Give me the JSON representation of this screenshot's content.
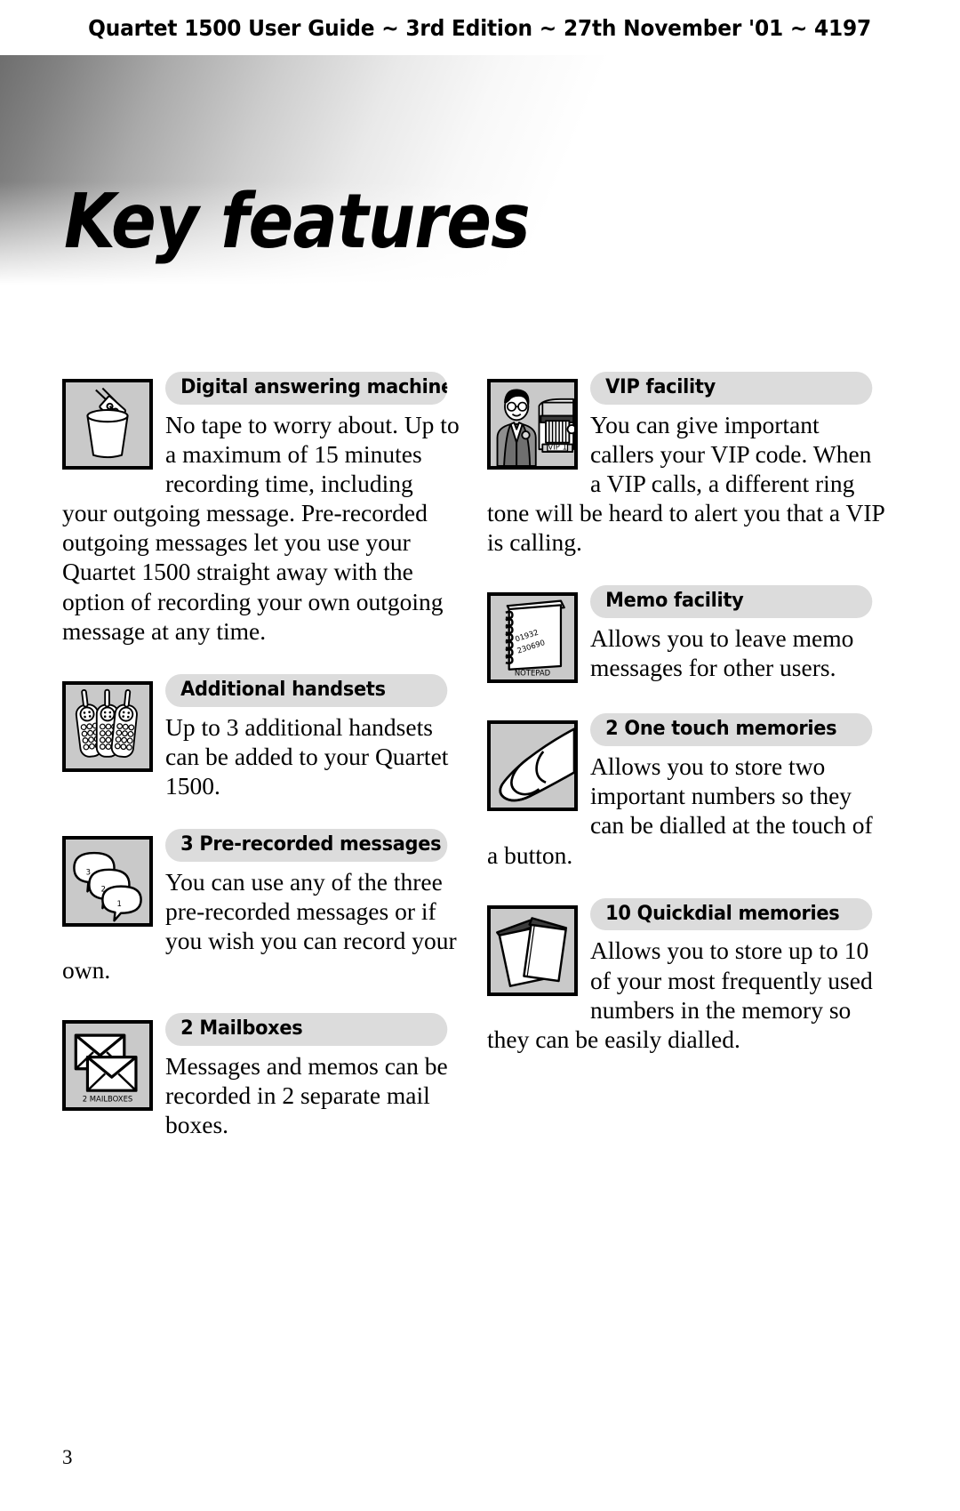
{
  "header": {
    "running_head": "Quartet 1500 User Guide ~ 3rd Edition ~ 27th November '01 ~ 4197"
  },
  "page": {
    "title": "Key features",
    "number": "3"
  },
  "colors": {
    "icon_box_fill": "#c9c9c9",
    "label_pill_fill": "#dcdcdc",
    "ink": "#000000",
    "banner_gradient_start": "#6e6e6e",
    "banner_gradient_end": "#ffffff"
  },
  "columns": {
    "left": [
      {
        "icon_name": "cassette-tape-into-bin-icon",
        "label": "Digital answering machine",
        "body": "No tape to worry about. Up to a maximum of 15 minutes recording time, including your outgoing message. Pre-recorded outgoing messages let you use your Quartet 1500 straight away with the option of recording your own outgoing message at any time."
      },
      {
        "icon_name": "three-cordless-handsets-icon",
        "label": "Additional handsets",
        "body": "Up to 3 additional handsets can be added to your Quartet 1500."
      },
      {
        "icon_name": "three-speech-bubbles-icon",
        "icon_caption": [
          "3",
          "2",
          "1"
        ],
        "label": "3 Pre-recorded messages",
        "body": "You can use any of the three pre-recorded messages or if you wish you can record your own."
      },
      {
        "icon_name": "two-envelopes-icon",
        "icon_caption": "2 MAILBOXES",
        "label": "2 Mailboxes",
        "body": "Messages and memos can be recorded in 2 separate mail boxes."
      }
    ],
    "right": [
      {
        "icon_name": "vip-man-and-car-icon",
        "icon_caption": "VIP 1",
        "label": "VIP facility",
        "body": "You can give important callers your VIP code. When a VIP calls, a different ring tone will be heard to alert you that a VIP is calling."
      },
      {
        "icon_name": "spiral-notepad-icon",
        "icon_caption": "NOTEPAD",
        "icon_note": "01932 230690",
        "label": "Memo facility",
        "body": "Allows you to leave memo messages for other users."
      },
      {
        "icon_name": "thumb-press-button-icon",
        "label": "2 One touch memories",
        "body": "Allows you to store two important numbers so they can be dialled at the touch of a button."
      },
      {
        "icon_name": "address-cards-icon",
        "label": "10 Quickdial memories",
        "body": "Allows you to store up to 10 of your most frequently used numbers in the memory so they can be easily dialled."
      }
    ]
  }
}
